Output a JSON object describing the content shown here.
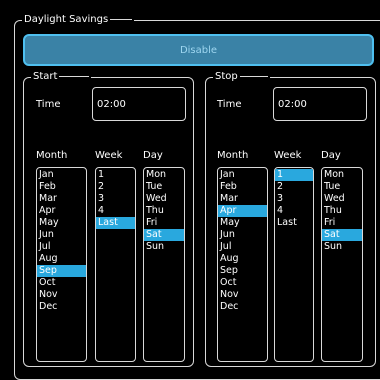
{
  "title": "Daylight Savings",
  "disable_button": "Disable",
  "start": {
    "legend": "Start",
    "time_label": "Time",
    "time_value": "02:00",
    "month_header": "Month",
    "week_header": "Week",
    "day_header": "Day",
    "months": [
      "Jan",
      "Feb",
      "Mar",
      "Apr",
      "May",
      "Jun",
      "Jul",
      "Aug",
      "Sep",
      "Oct",
      "Nov",
      "Dec"
    ],
    "weeks": [
      "1",
      "2",
      "3",
      "4",
      "Last"
    ],
    "days": [
      "Mon",
      "Tue",
      "Wed",
      "Thu",
      "Fri",
      "Sat",
      "Sun"
    ],
    "selected_month": "Sep",
    "selected_week": "Last",
    "selected_day": "Sat"
  },
  "stop": {
    "legend": "Stop",
    "time_label": "Time",
    "time_value": "02:00",
    "month_header": "Month",
    "week_header": "Week",
    "day_header": "Day",
    "months": [
      "Jan",
      "Feb",
      "Mar",
      "Apr",
      "May",
      "Jun",
      "Jul",
      "Aug",
      "Sep",
      "Oct",
      "Nov",
      "Dec"
    ],
    "weeks": [
      "1",
      "2",
      "3",
      "4",
      "Last"
    ],
    "days": [
      "Mon",
      "Tue",
      "Wed",
      "Thu",
      "Fri",
      "Sat",
      "Sun"
    ],
    "selected_month": "Apr",
    "selected_week": "1",
    "selected_day": "Sat"
  },
  "colors": {
    "background": "#000000",
    "accent": "#29a8de",
    "button_fill": "#3a82a6",
    "border": "#d9d9d9"
  }
}
